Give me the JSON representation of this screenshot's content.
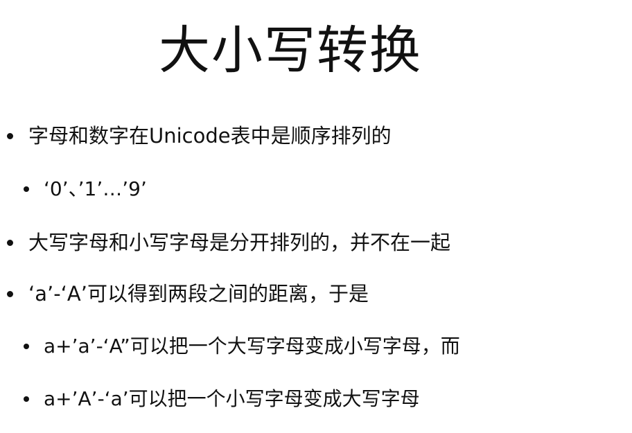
{
  "slide": {
    "title": "大小写转换",
    "bullets": [
      {
        "level": 1,
        "text": "字母和数字在Unicode表中是顺序排列的"
      },
      {
        "level": 2,
        "text": "‘0’、’1’…’9’"
      },
      {
        "level": 1,
        "text": "大写字母和小写字母是分开排列的，并不在一起"
      },
      {
        "level": 1,
        "text": "‘a’-‘A’可以得到两段之间的距离，于是"
      },
      {
        "level": 2,
        "text": "a+’a’-‘A”可以把一个大写字母变成小写字母，而"
      },
      {
        "level": 2,
        "text": "a+’A’-‘a’可以把一个小写字母变成大写字母"
      }
    ],
    "bullet_icon": "bullet-dot",
    "colors": {
      "background": "#ffffff",
      "text": "#111111"
    }
  }
}
